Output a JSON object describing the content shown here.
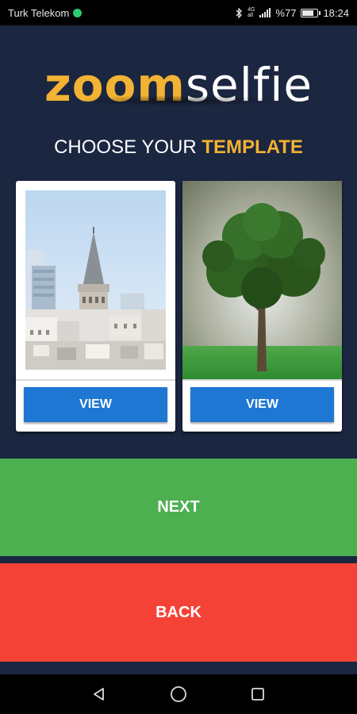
{
  "status_bar": {
    "carrier": "Turk Telekom",
    "network_top": "4G",
    "network_bottom": "all",
    "battery_text": "%77",
    "battery_level": 0.77,
    "time": "18:24"
  },
  "app": {
    "logo_part1": "zoom",
    "logo_part2": "selfie",
    "heading_prefix": "CHOOSE YOUR",
    "heading_accent": "TEMPLATE",
    "templates": [
      {
        "view_label": "VIEW",
        "image": "galata-tower-photo"
      },
      {
        "view_label": "VIEW",
        "image": "tree-on-grass-photo"
      }
    ],
    "next_label": "NEXT",
    "back_label": "BACK"
  },
  "colors": {
    "background": "#1b2640",
    "accent": "#f2b233",
    "view_button": "#1e77d3",
    "next": "#4caf50",
    "back": "#f44336"
  },
  "nav_bar": {
    "icons": [
      "back-triangle-icon",
      "home-circle-icon",
      "recents-square-icon"
    ]
  }
}
